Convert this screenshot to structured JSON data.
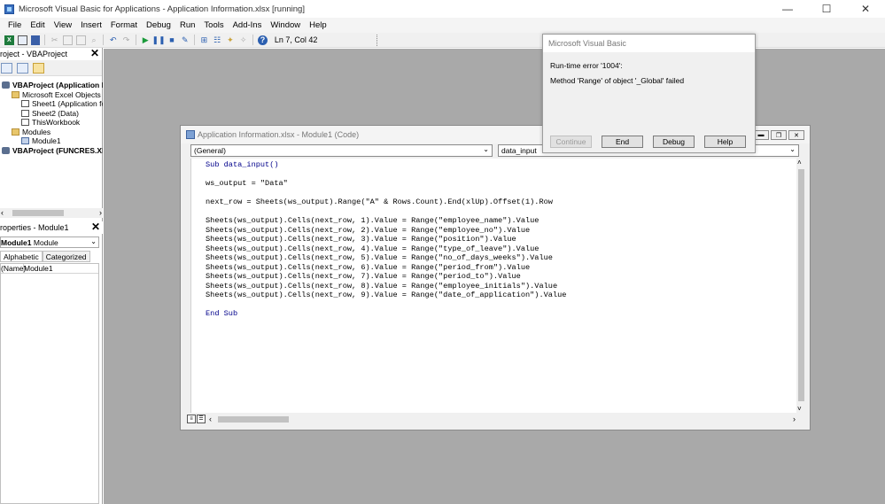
{
  "window": {
    "title": "Microsoft Visual Basic for Applications - Application Information.xlsx [running]",
    "minimize": "—",
    "maximize": "☐",
    "close": "✕"
  },
  "menu": [
    "File",
    "Edit",
    "View",
    "Insert",
    "Format",
    "Debug",
    "Run",
    "Tools",
    "Add-Ins",
    "Window",
    "Help"
  ],
  "toolbar": {
    "status": "Ln 7, Col 42"
  },
  "project_panel": {
    "title": "roject - VBAProject",
    "tree": [
      {
        "label": "VBAProject (Application In",
        "bold": true,
        "indent": 0,
        "icon": "project"
      },
      {
        "label": "Microsoft Excel Objects",
        "bold": false,
        "indent": 1,
        "icon": "folder"
      },
      {
        "label": "Sheet1 (Application for",
        "bold": false,
        "indent": 2,
        "icon": "sheet"
      },
      {
        "label": "Sheet2 (Data)",
        "bold": false,
        "indent": 2,
        "icon": "sheet"
      },
      {
        "label": "ThisWorkbook",
        "bold": false,
        "indent": 2,
        "icon": "sheet"
      },
      {
        "label": "Modules",
        "bold": false,
        "indent": 1,
        "icon": "folder"
      },
      {
        "label": "Module1",
        "bold": false,
        "indent": 2,
        "icon": "module"
      },
      {
        "label": "VBAProject (FUNCRES.XLAI",
        "bold": true,
        "indent": 0,
        "icon": "project"
      }
    ]
  },
  "properties_panel": {
    "title": "roperties - Module1",
    "object_name": "Module1",
    "object_type": "Module",
    "tabs": [
      "Alphabetic",
      "Categorized"
    ],
    "rows": [
      {
        "key": "(Name)",
        "value": "Module1"
      }
    ]
  },
  "code_window": {
    "title": "Application Information.xlsx - Module1 (Code)",
    "object_combo": "(General)",
    "proc_combo": "data_input",
    "lines": [
      "Sub data_input()",
      "",
      "ws_output = \"Data\"",
      "",
      "next_row = Sheets(ws_output).Range(\"A\" & Rows.Count).End(xlUp).Offset(1).Row",
      "",
      "Sheets(ws_output).Cells(next_row, 1).Value = Range(\"employee_name\").Value",
      "Sheets(ws_output).Cells(next_row, 2).Value = Range(\"employee_no\").Value",
      "Sheets(ws_output).Cells(next_row, 3).Value = Range(\"position\").Value",
      "Sheets(ws_output).Cells(next_row, 4).Value = Range(\"type_of_leave\").Value",
      "Sheets(ws_output).Cells(next_row, 5).Value = Range(\"no_of_days_weeks\").Value",
      "Sheets(ws_output).Cells(next_row, 6).Value = Range(\"period_from\").Value",
      "Sheets(ws_output).Cells(next_row, 7).Value = Range(\"period_to\").Value",
      "Sheets(ws_output).Cells(next_row, 8).Value = Range(\"employee_initials\").Value",
      "Sheets(ws_output).Cells(next_row, 9).Value = Range(\"date_of_application\").Value",
      "",
      "End Sub"
    ],
    "keyword_lines": [
      0,
      16
    ]
  },
  "dialog": {
    "title": "Microsoft Visual Basic",
    "error_line": "Run-time error '1004':",
    "message": "Method 'Range' of object '_Global' failed",
    "buttons": [
      {
        "label": "Continue",
        "enabled": false
      },
      {
        "label": "End",
        "enabled": true
      },
      {
        "label": "Debug",
        "enabled": true
      },
      {
        "label": "Help",
        "enabled": true
      }
    ]
  },
  "colors": {
    "workspace": "#a9a9a9",
    "keyword": "#00008b"
  }
}
